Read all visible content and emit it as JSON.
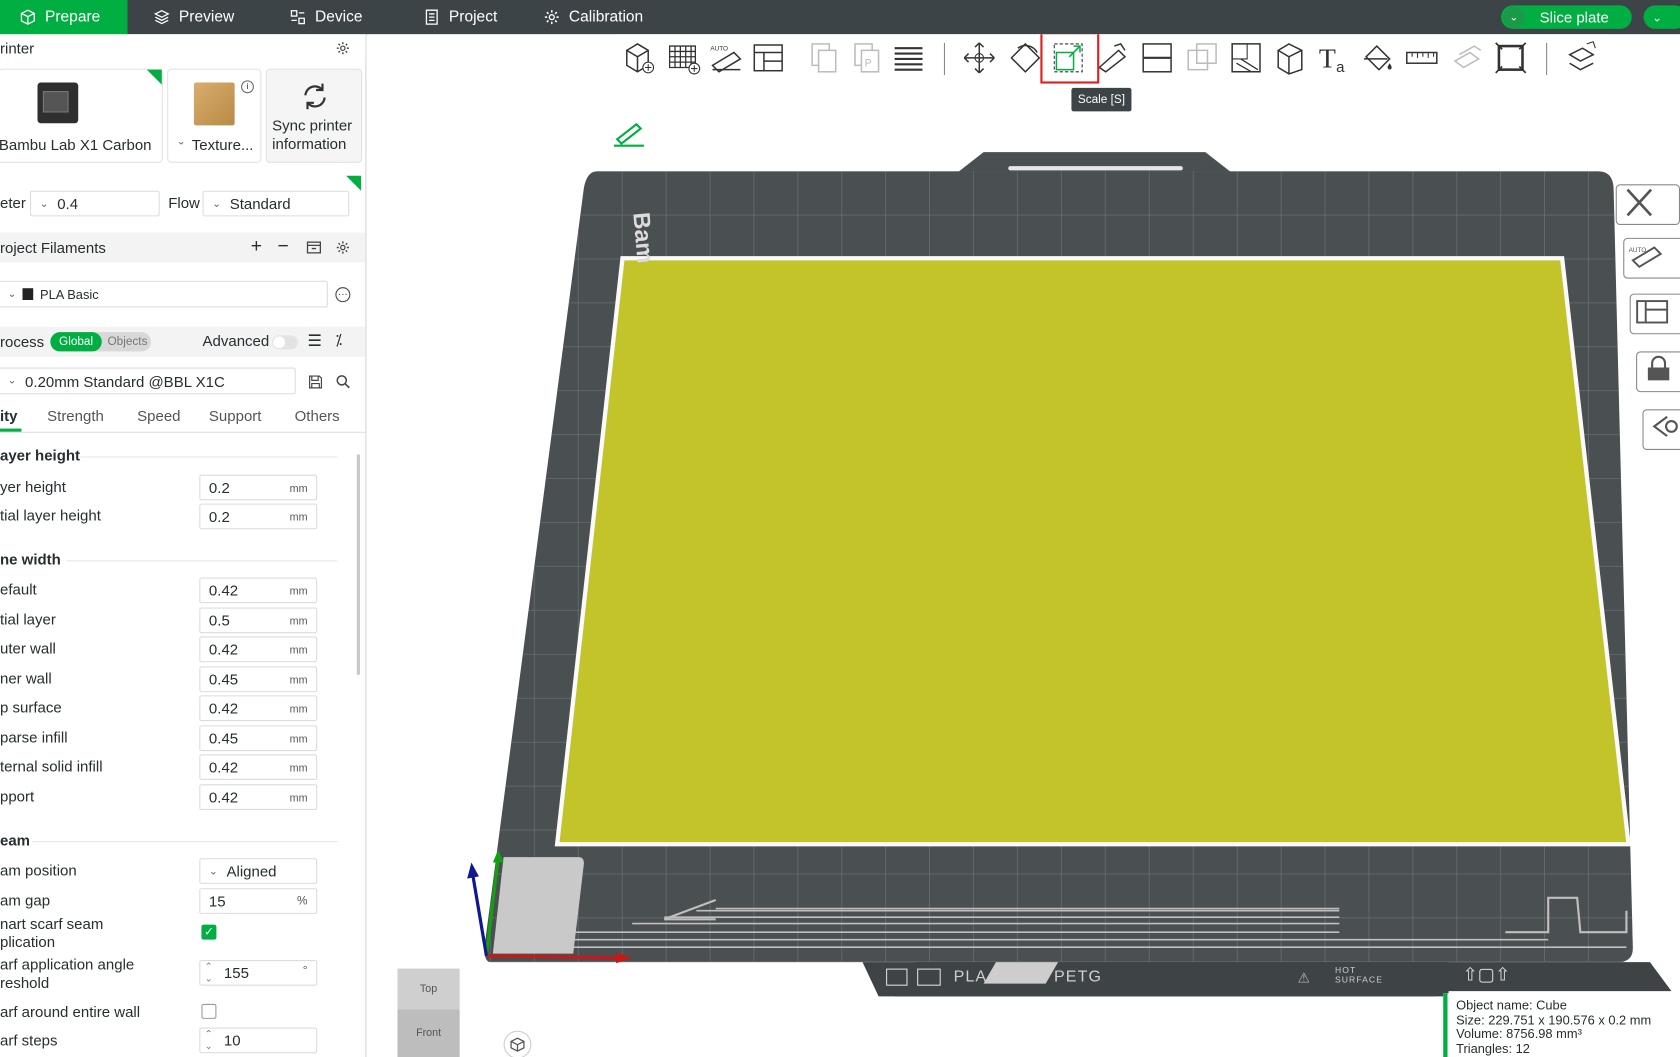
{
  "topbar": {
    "tabs": [
      {
        "label": "Prepare",
        "icon": "cube-icon",
        "active": true
      },
      {
        "label": "Preview",
        "icon": "layers-icon"
      },
      {
        "label": "Device",
        "icon": "device-icon"
      },
      {
        "label": "Project",
        "icon": "document-icon"
      },
      {
        "label": "Calibration",
        "icon": "gear-icon"
      }
    ],
    "slice_label": "Slice plate",
    "accent": "#00ae42",
    "bg": "#3c4447"
  },
  "printer": {
    "section_title": "rinter",
    "printer_name": "Bambu Lab X1 Carbon",
    "plate_name": "Texture...",
    "sync_label_1": "Sync printer",
    "sync_label_2": "information",
    "nozzle_label": "eter",
    "nozzle_value": "0.4",
    "flow_label": "Flow",
    "flow_value": "Standard"
  },
  "filaments": {
    "section_title": "roject Filaments",
    "items": [
      {
        "name": "PLA Basic"
      }
    ]
  },
  "process": {
    "section_title": "rocess",
    "toggle_global": "Global",
    "toggle_objects": "Objects",
    "advanced_label": "Advanced",
    "preset": "0.20mm Standard @BBL X1C",
    "tabs": [
      "ity",
      "Strength",
      "Speed",
      "Support",
      "Others"
    ]
  },
  "settings": {
    "layer_height_title": "ayer height",
    "layer_height_label": "yer height",
    "layer_height_value": "0.2",
    "initial_layer_label": "tial layer height",
    "initial_layer_value": "0.2",
    "line_width_title": "ne width",
    "line_widths": [
      {
        "label": "efault",
        "value": "0.42"
      },
      {
        "label": "tial layer",
        "value": "0.5"
      },
      {
        "label": "uter wall",
        "value": "0.42"
      },
      {
        "label": "ner wall",
        "value": "0.45"
      },
      {
        "label": "p surface",
        "value": "0.42"
      },
      {
        "label": "parse infill",
        "value": "0.45"
      },
      {
        "label": "ternal solid infill",
        "value": "0.42"
      },
      {
        "label": "pport",
        "value": "0.42"
      }
    ],
    "unit_mm": "mm",
    "seam_title": "eam",
    "seam_position_label": "am position",
    "seam_position_value": "Aligned",
    "seam_gap_label": "am gap",
    "seam_gap_value": "15",
    "seam_gap_unit": "%",
    "scarf_app_label_1": "nart scarf seam",
    "scarf_app_label_2": "plication",
    "scarf_app_checked": true,
    "scarf_angle_label_1": "arf application angle",
    "scarf_angle_label_2": "reshold",
    "scarf_angle_value": "155",
    "scarf_angle_unit": "°",
    "scarf_entire_label": "arf around entire wall",
    "scarf_entire_checked": false,
    "scarf_steps_label": "arf steps",
    "scarf_steps_value": "10"
  },
  "viewport": {
    "tooltip": "Scale [S]",
    "bed_text": "PLA / ABS / PETG",
    "hot_surface_1": "HOT",
    "hot_surface_2": "SURFACE",
    "brand_text": "Bam",
    "model_color": "#c3c42a",
    "view_cube_top": "Top",
    "view_cube_front": "Front",
    "object_info": {
      "name": "Object name: Cube",
      "size": "Size: 229.751 x 190.576 x 0.2 mm",
      "volume": "Volume: 8756.98 mm³",
      "triangles": "Triangles: 12"
    }
  },
  "toolbar_icons": [
    "add-icon",
    "arrange-grid-icon",
    "auto-orient-icon",
    "plate-layout-icon",
    "copy-icon",
    "paste-icon",
    "layers-stack-icon",
    "move-icon",
    "rotate-icon",
    "scale-icon",
    "lay-on-face-icon",
    "cut-icon",
    "boolean-icon",
    "support-paint-icon",
    "seam-paint-icon",
    "text-icon",
    "color-paint-icon",
    "measure-icon",
    "assemble-icon",
    "fit-icon",
    "explode-icon"
  ]
}
